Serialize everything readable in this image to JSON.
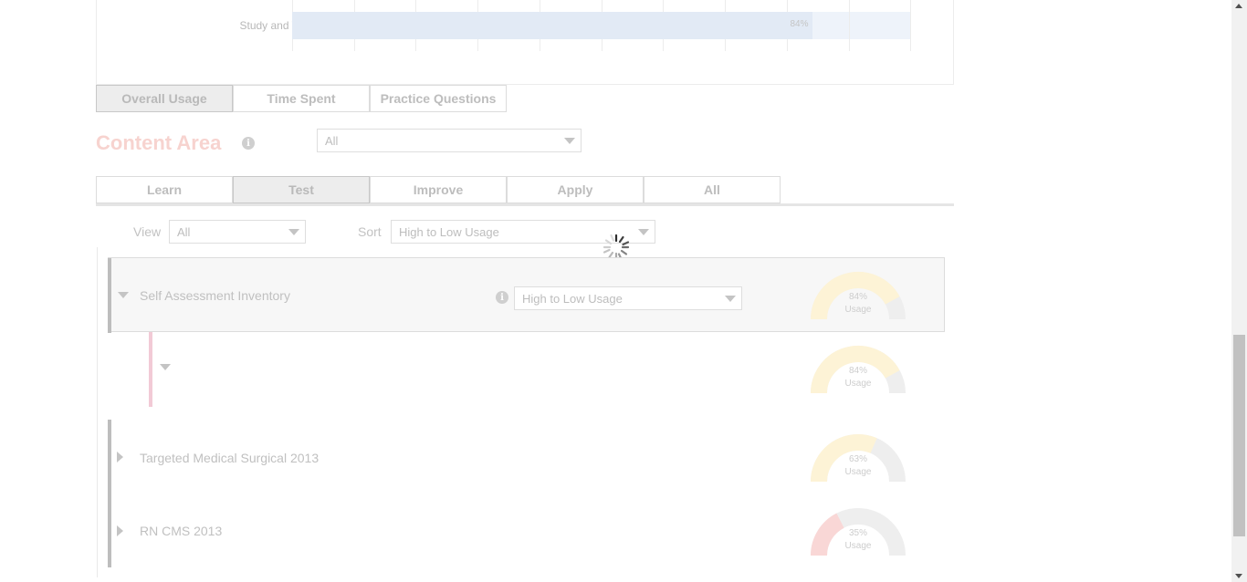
{
  "chart": {
    "row_label": "Study and Testing Skills",
    "bar_value_label": "84%",
    "bar_fraction": 0.84
  },
  "usage_tabs": [
    {
      "label": "Overall Usage",
      "active": true
    },
    {
      "label": "Time Spent",
      "active": false
    },
    {
      "label": "Practice Questions",
      "active": false
    }
  ],
  "content_area": {
    "title": "Content Area",
    "info_glyph": "i",
    "filter_value": "All"
  },
  "content_tabs": [
    {
      "label": "Learn",
      "active": false
    },
    {
      "label": "Test",
      "active": true
    },
    {
      "label": "Improve",
      "active": false
    },
    {
      "label": "Apply",
      "active": false
    },
    {
      "label": "All",
      "active": false
    }
  ],
  "filters": {
    "view_label": "View",
    "view_value": "All",
    "sort_label": "Sort",
    "sort_value": "High to Low Usage"
  },
  "rows": [
    {
      "title": "Self Assessment Inventory",
      "expanded": true,
      "sort_value": "High to Low Usage",
      "usage_pct": "84%",
      "usage_label": "Usage",
      "usage_fraction": 0.84
    },
    {
      "title": "",
      "expanded": true,
      "usage_pct": "84%",
      "usage_label": "Usage",
      "usage_fraction": 0.84
    },
    {
      "title": "Targeted Medical Surgical 2013",
      "expanded": false,
      "usage_pct": "63%",
      "usage_label": "Usage",
      "usage_fraction": 0.63
    },
    {
      "title": "RN CMS 2013",
      "expanded": false,
      "usage_pct": "35%",
      "usage_label": "Usage",
      "usage_fraction": 0.35
    }
  ],
  "colors": {
    "chart_bar": "#e2eaf5",
    "gauge_high": "#fdf3d6",
    "gauge_low": "#f9d7d6",
    "gauge_track": "#eeeeee",
    "title_accent": "#f7d3cf",
    "sub_row_accent": "#f2cad6"
  },
  "icons": [
    "info-icon",
    "chevron-down-icon",
    "chevron-right-icon",
    "loading-spinner-icon"
  ]
}
